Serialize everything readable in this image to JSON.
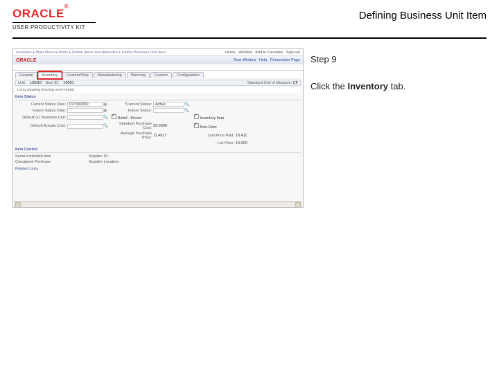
{
  "header": {
    "brand": "ORACLE",
    "brand_sub": "USER PRODUCTIVITY KIT",
    "page_title": "Defining Business Unit Item"
  },
  "instructions": {
    "step_label": "Step 9",
    "line_prefix": "Click the ",
    "line_bold": "Inventory",
    "line_suffix": " tab."
  },
  "shot": {
    "crumbs": "Favorites ▸  Main Menu ▸  Items ▸  Define Items and Attributes ▸  Define Business Unit Item",
    "toplinks": [
      "Home",
      "Worklist",
      "Add to Favorites",
      "Sign out"
    ],
    "brandbar_actions": [
      "New Window",
      "Help",
      "Personalize Page"
    ],
    "tabs": [
      "General",
      "Inventory",
      "Custom/Ship",
      "Manufacturing",
      "Planning",
      "Custom",
      "Configuration"
    ],
    "active_tab_index": 1,
    "strip": {
      "unit_label": "Unit:",
      "unit_value": "US010",
      "item_label": "Item ID:",
      "item_value": "10001",
      "uom_label": "Standard Unit of Measure:",
      "uom_value": "CF"
    },
    "strip2": {
      "desc": "Long wearing bearing semi-metal"
    },
    "section_itemstatus_title": "Item Status",
    "grid": {
      "curr_status_date_l": "Current Status Date:",
      "curr_status_date_v": "07/20/2000",
      "curr_status_l": "*Current Status:",
      "curr_status_v": "Active",
      "future_status_date_l": "Future Status Date:",
      "future_status_l": "Future Status:",
      "default_gl_l": "Default GL Business Unit:",
      "relief_l": "Relief - Priced",
      "relief_ck": true,
      "inv_item_l": "Inventory Item",
      "inv_item_ck": true,
      "default_actuals_l": "Default Actuals Cost:",
      "std_cost_l": "Standard Purchase Cost:",
      "std_cost_v": "25.0000",
      "non_own_l": "Non-Own:",
      "non_own_ck": true,
      "last_price_paid_l": "Last Price Paid:",
      "last_price_paid_v": "10.411",
      "avg_price_l": "Average Purchase Price:",
      "avg_price_v": "11.4917",
      "list_price_l": "List Price:",
      "list_price_v": "10.000"
    },
    "inv_control_title": "Item Control",
    "inv_grid": {
      "serial_l": "Serial-controlled item",
      "serial_ck": true,
      "supplier_l": "Supplier ID:",
      "consigned_l": "Consigned Purchase",
      "consigned_ck": true,
      "supploc_l": "Supplier Location:"
    },
    "related": "Related Links"
  }
}
